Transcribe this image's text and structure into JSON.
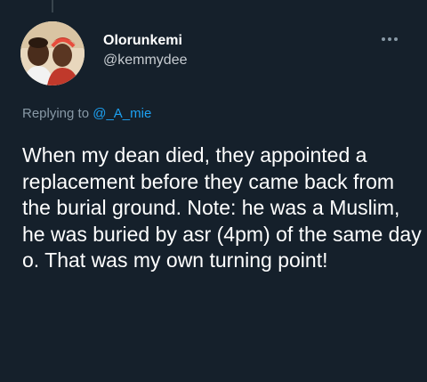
{
  "tweet": {
    "author_name": "Olorunkemi",
    "author_handle": "@kemmydee",
    "replying_prefix": "Replying to ",
    "replying_mention": "@_A_mie",
    "text": "When my dean died, they appointed a replacement before they came back from the burial ground. Note: he was a Muslim, he was buried by asr (4pm) of the same day o. That was my own turning point!"
  },
  "icons": {
    "more": "more-horizontal-icon",
    "avatar": "profile-photo"
  },
  "colors": {
    "background": "#15202b",
    "text_primary": "#ffffff",
    "text_secondary": "#8899a6",
    "accent": "#1da1f2"
  }
}
